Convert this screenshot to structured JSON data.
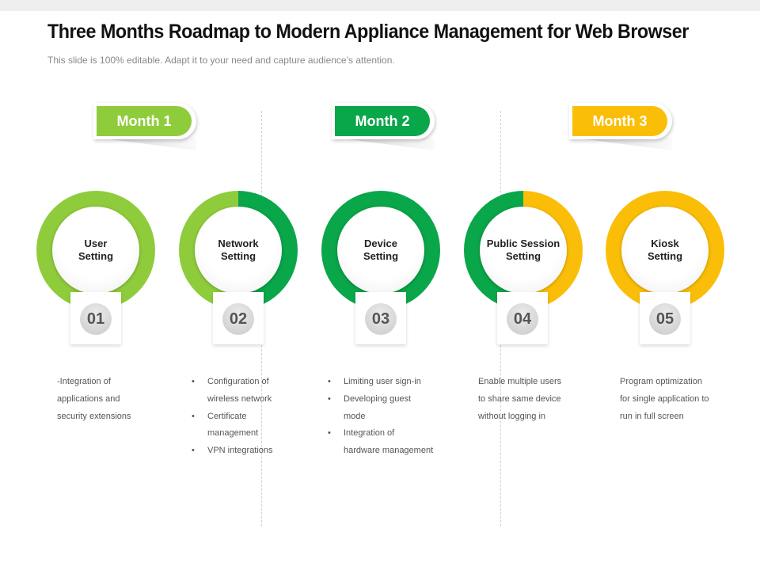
{
  "slide": {
    "title": "Three Months Roadmap to Modern Appliance Management for Web Browser",
    "subtitle": "This slide is 100% editable. Adapt it to your need and capture audience’s attention."
  },
  "months": [
    {
      "label": "Month 1",
      "color": "#8fcc3c"
    },
    {
      "label": "Month 2",
      "color": "#0aa64a"
    },
    {
      "label": "Month 3",
      "color": "#fbbe08"
    }
  ],
  "steps": [
    {
      "label_line1": "User",
      "label_line2": "Setting",
      "number": "01"
    },
    {
      "label_line1": "Network",
      "label_line2": "Setting",
      "number": "02"
    },
    {
      "label_line1": "Device",
      "label_line2": "Setting",
      "number": "03"
    },
    {
      "label_line1": "Public Session",
      "label_line2": "Setting",
      "number": "04"
    },
    {
      "label_line1": "Kiosk",
      "label_line2": "Setting",
      "number": "05"
    }
  ],
  "descriptions": {
    "step1": [
      "-Integration of",
      "applications and",
      "security extensions"
    ],
    "step2": {
      "bullet": "•",
      "items": [
        [
          "Configuration of",
          "wireless network"
        ],
        [
          "Certificate",
          "management"
        ],
        [
          "VPN integrations"
        ]
      ]
    },
    "step3": {
      "bullet": "•",
      "items": [
        [
          "Limiting user sign-in"
        ],
        [
          "Developing guest",
          "mode"
        ],
        [
          "Integration of",
          "hardware management"
        ]
      ]
    },
    "step4": [
      "Enable multiple users",
      "to share same device",
      "without logging in"
    ],
    "step5": [
      "Program optimization",
      "for single application to",
      "run in full screen"
    ]
  },
  "colors": {
    "lime": "#8fcc3c",
    "green": "#0aa64a",
    "yellow": "#fbbe08"
  }
}
